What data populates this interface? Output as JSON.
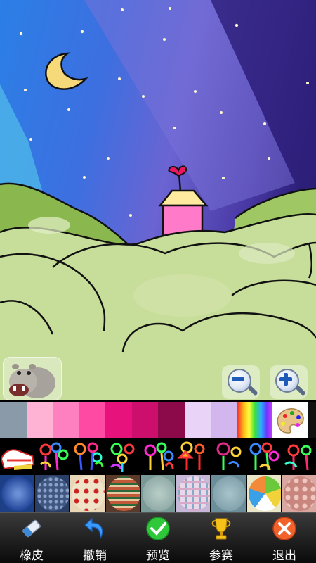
{
  "toolbar": {
    "eraser_label": "橡皮",
    "undo_label": "撤销",
    "preview_label": "预览",
    "contest_label": "参赛",
    "exit_label": "退出"
  },
  "palette": {
    "colors": [
      "#8a9aa8",
      "#ffb3d4",
      "#ff80c0",
      "#ff4aa4",
      "#e8127c",
      "#cc0e6c",
      "#8c0a4a",
      "#e9d4f8",
      "#d4b6ef"
    ],
    "rainbow": "rainbow-swatch",
    "more": "palette-icon"
  },
  "brushes": [
    "sneaker-brush-icon",
    "rainbow-flower-brush-icon",
    "rainbow-flower-brush-icon",
    "rainbow-flower-brush-icon",
    "rainbow-flower-brush-icon",
    "rainbow-flower-brush-icon",
    "rainbow-flower-brush-icon",
    "rainbow-flower-brush-icon",
    "rainbow-flower-brush-icon"
  ],
  "patterns": [
    "snowflake-pattern",
    "blue-dots-pattern",
    "doll-pattern",
    "stripe-pattern",
    "teal-dots-pattern",
    "plaid-pattern",
    "teal-pattern",
    "fruit-pattern",
    "pink-pattern"
  ],
  "zoom": {
    "out": "zoom-out-icon",
    "in": "zoom-in-icon"
  }
}
